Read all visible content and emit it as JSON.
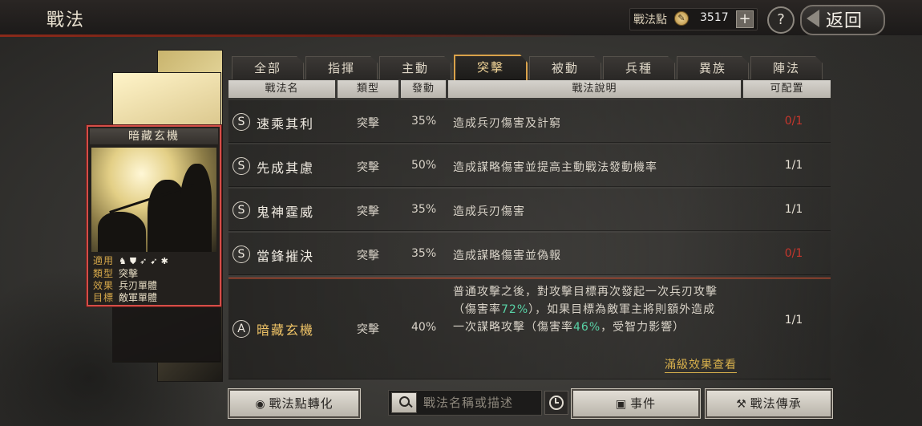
{
  "header": {
    "title": "戰法",
    "points_label": "戰法點",
    "points_value": "3517",
    "plus_label": "+",
    "help_label": "?",
    "back_label": "返回"
  },
  "card": {
    "title": "暗藏玄機",
    "info": [
      {
        "key": "適用",
        "value": ""
      },
      {
        "key": "類型",
        "value": "突擊"
      },
      {
        "key": "效果",
        "value": "兵刃單體"
      },
      {
        "key": "目標",
        "value": "敵軍單體"
      }
    ],
    "applicable_icons": [
      "cavalry-icon",
      "shield-icon",
      "bow-icon",
      "spear-icon",
      "wheel-icon"
    ]
  },
  "tabs": [
    "全部",
    "指揮",
    "主動",
    "突擊",
    "被動",
    "兵種",
    "異族",
    "陣法"
  ],
  "active_tab": "突擊",
  "columns": [
    "戰法名",
    "類型",
    "發動",
    "戰法說明",
    "可配置"
  ],
  "rows": [
    {
      "grade": "S",
      "name": "速乘其利",
      "type": "突擊",
      "rate": "35%",
      "desc": "造成兵刃傷害及計窮",
      "count": "0/1",
      "count_color": "#c8362c"
    },
    {
      "grade": "S",
      "name": "先成其慮",
      "type": "突擊",
      "rate": "50%",
      "desc": "造成謀略傷害並提高主動戰法發動機率",
      "count": "1/1",
      "count_color": "#e8e2d6"
    },
    {
      "grade": "S",
      "name": "鬼神霆威",
      "type": "突擊",
      "rate": "35%",
      "desc": "造成兵刃傷害",
      "count": "1/1",
      "count_color": "#e8e2d6"
    },
    {
      "grade": "S",
      "name": "當鋒摧決",
      "type": "突擊",
      "rate": "35%",
      "desc": "造成謀略傷害並偽報",
      "count": "0/1",
      "count_color": "#c8362c"
    }
  ],
  "selected_row": {
    "grade": "A",
    "name": "暗藏玄機",
    "type": "突擊",
    "rate": "40%",
    "desc": {
      "l1": "普通攻擊之後，對攻擊目標再次發起一次兵刃攻擊",
      "l2a": "（傷害率",
      "l2b": "72%",
      "l2c": "），如果目標為敵軍主將則額外造成",
      "l3a": "一次謀略攻擊（傷害率",
      "l3b": "46%",
      "l3c": "，受智力影響）"
    },
    "count": "1/1",
    "full_effect_link": "滿級效果查看"
  },
  "bottom": {
    "convert_label": "戰法點轉化",
    "search_placeholder": "戰法名稱或描述",
    "event_label": "事件",
    "inherit_label": "戰法傳承"
  }
}
